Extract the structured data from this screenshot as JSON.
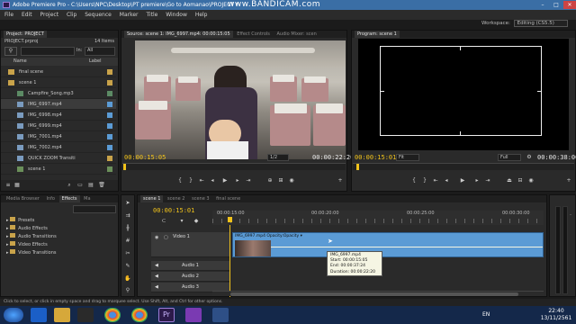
{
  "titlebar": {
    "title": "Adobe Premiere Pro - C:\\Users\\NPC\\Desktop\\PT premiere\\Go to Aomanao\\PROJECT *",
    "watermark": "www.BANDICAM.com",
    "minimize": "–",
    "maximize": "□",
    "close": "✕"
  },
  "menu": [
    "File",
    "Edit",
    "Project",
    "Clip",
    "Sequence",
    "Marker",
    "Title",
    "Window",
    "Help"
  ],
  "workspace": {
    "label": "Workspace:",
    "value": "Editing (CS5.5)"
  },
  "project_panel": {
    "tab": "Project: PROJECT",
    "name": "PROJECT.prproj",
    "count": "14 Items",
    "in_label": "In:",
    "in_value": "All",
    "col_name": "Name",
    "col_label": "Label",
    "items": [
      {
        "name": "final scene",
        "type": "folder",
        "color": "#c9a34a"
      },
      {
        "name": "scene 1",
        "type": "folder",
        "color": "#c9a34a"
      },
      {
        "name": "Campfire_Song.mp3",
        "type": "audio",
        "color": "#5c8a64"
      },
      {
        "name": "IMG_6997.mp4",
        "type": "clip",
        "color": "#5b9bd5"
      },
      {
        "name": "IMG_6998.mp4",
        "type": "clip",
        "color": "#5b9bd5"
      },
      {
        "name": "IMG_6999.mp4",
        "type": "clip",
        "color": "#5b9bd5"
      },
      {
        "name": "IMG_7001.mp4",
        "type": "clip",
        "color": "#5b9bd5"
      },
      {
        "name": "IMG_7002.mp4",
        "type": "clip",
        "color": "#5b9bd5"
      },
      {
        "name": "QUICK ZOOM Transiti",
        "type": "clip",
        "color": "#c9a34a"
      },
      {
        "name": "scene 1",
        "type": "sequence",
        "color": "#6a8f5a"
      }
    ]
  },
  "effects_panel": {
    "tabs": [
      "Media Browser",
      "Info",
      "Effects",
      "Ma"
    ],
    "active_tab": "Effects",
    "items": [
      "Presets",
      "Audio Effects",
      "Audio Transitions",
      "Video Effects",
      "Video Transitions"
    ]
  },
  "source_monitor": {
    "tabs": [
      "Source: scene 1: IMG_6997.mp4: 00:00:15:05",
      "Effect Controls",
      "Audio Mixer: scen"
    ],
    "timecode_in": "00:00:15:05",
    "fit": "1/2",
    "timecode_dur": "00:00:22:20"
  },
  "program_monitor": {
    "tab": "Program: scene 1",
    "timecode": "00:00:15:01",
    "fit": "Fit",
    "quality": "Full",
    "duration": "00:00:38:00"
  },
  "timeline": {
    "tabs": [
      "scene 1",
      "scene 2",
      "scene 3",
      "final scene"
    ],
    "timecode": "00:00:15:01",
    "ruler": [
      "00:00:15:00",
      "00:00:20:00",
      "00:00:25:00",
      "00:00:30:00"
    ],
    "tracks": [
      {
        "name": "Video 1",
        "kind": "video"
      },
      {
        "name": "Audio 1",
        "kind": "audio"
      },
      {
        "name": "Audio 2",
        "kind": "audio"
      },
      {
        "name": "Audio 3",
        "kind": "audio"
      }
    ],
    "clip_label": "IMG_6997.mp4  Opacity:Opacity ▾",
    "tooltip": {
      "name": "IMG_6997.mp4",
      "start": "Start: 00:00:15:05",
      "end": "End: 00:00:37:24",
      "duration": "Duration: 00:00:22:20"
    }
  },
  "status": "Click to select, or click in empty space and drag to marquee select. Use Shift, Alt, and Ctrl for other options.",
  "taskbar": {
    "apps": [
      "start",
      "ie",
      "explorer",
      "chrome",
      "chrome-alt",
      "premiere",
      "bandicam",
      "media",
      "word-like"
    ],
    "lang": "EN",
    "time": "22:40",
    "date": "13/11/2561"
  },
  "colors": {
    "timecode": "#f0c21b",
    "clip": "#5b9bd5",
    "accent": "#3a6ea5"
  }
}
